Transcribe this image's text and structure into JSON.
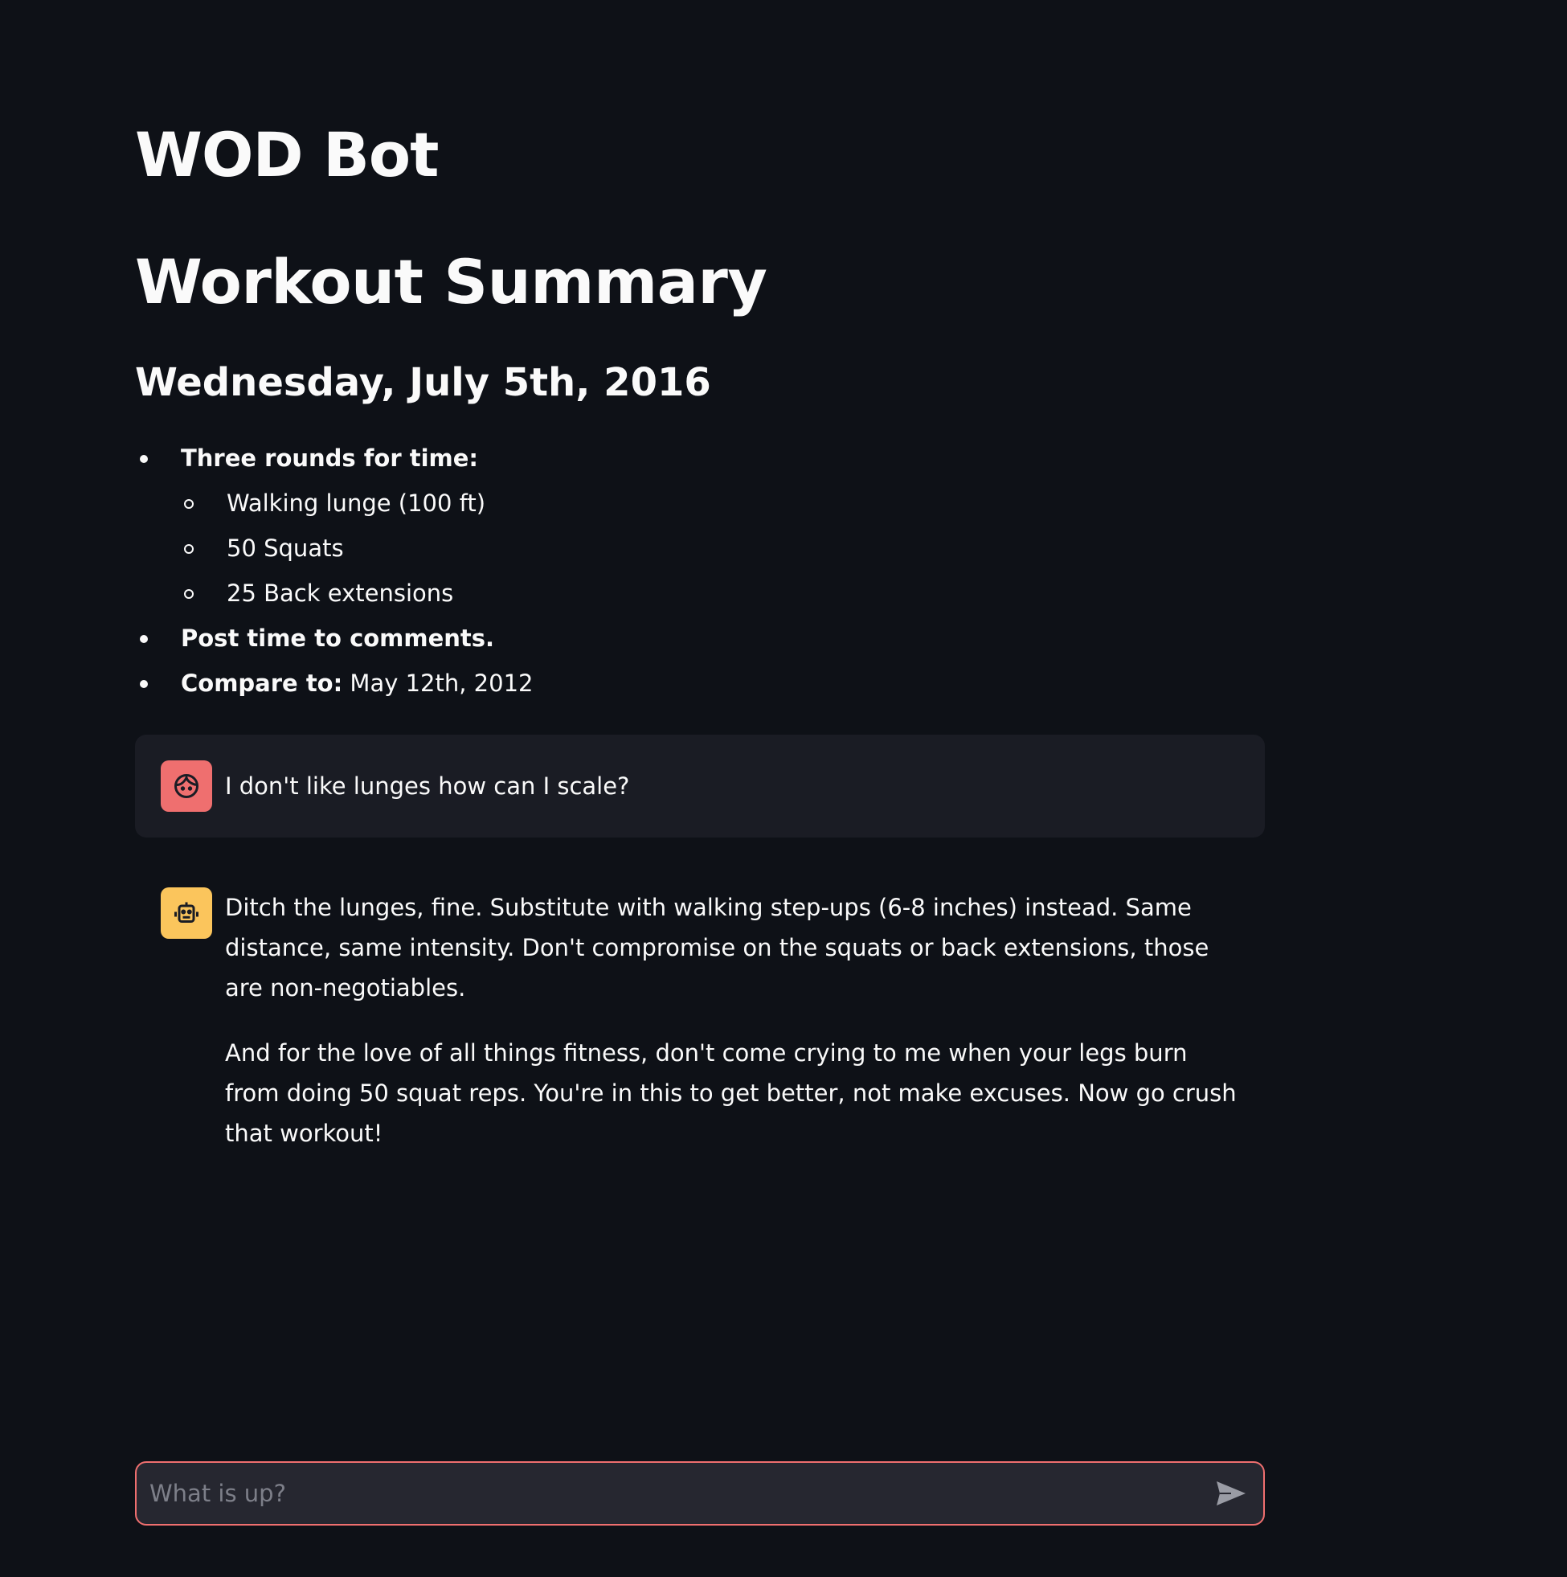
{
  "header": {
    "app_title": "WOD Bot",
    "section_title": "Workout Summary",
    "date": "Wednesday, July 5th, 2016"
  },
  "workout": {
    "item1_label": "Three rounds for time:",
    "subitems": [
      "Walking lunge (100 ft)",
      "50 Squats",
      "25 Back extensions"
    ],
    "item2_label": "Post time to comments.",
    "item3_label": "Compare to:",
    "item3_value": "May 12th, 2012"
  },
  "chat": {
    "user_message": "I don't like lunges how can I scale?",
    "bot_paragraphs": [
      "Ditch the lunges, fine. Substitute with walking step-ups (6-8 inches) instead. Same distance, same intensity. Don't compromise on the squats or back extensions, those are non-negotiables.",
      "And for the love of all things fitness, don't come crying to me when your legs burn from doing 50 squat reps. You're in this to get better, not make excuses. Now go crush that workout!"
    ],
    "user_avatar_icon": "user-face-icon",
    "bot_avatar_icon": "robot-icon"
  },
  "input": {
    "placeholder": "What is up?",
    "value": ""
  },
  "colors": {
    "background": "#0e1117",
    "user_avatar": "#ef6f6f",
    "bot_avatar": "#fbc55c",
    "input_border": "#ef6f6f"
  }
}
